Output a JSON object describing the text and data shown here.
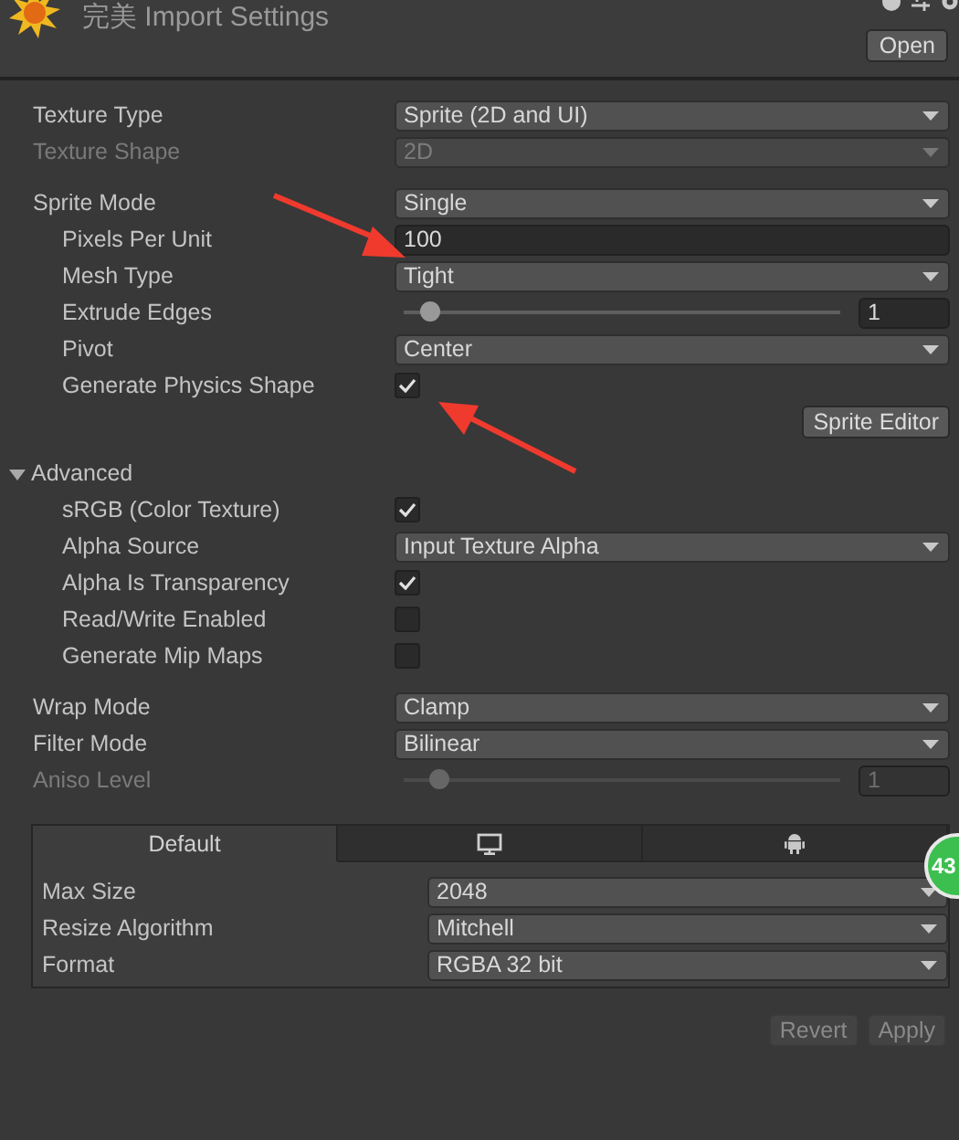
{
  "header": {
    "title": "完美 Import Settings",
    "open_button": "Open"
  },
  "groups": [
    {
      "rows": [
        {
          "kind": "dropdown",
          "label": "Texture Type",
          "value": "Sprite (2D and UI)",
          "disabled": false
        },
        {
          "kind": "dropdown",
          "label": "Texture Shape",
          "value": "2D",
          "disabled": true
        }
      ]
    },
    {
      "rows": [
        {
          "kind": "dropdown",
          "label": "Sprite Mode",
          "value": "Single",
          "disabled": false,
          "children": [
            {
              "kind": "input",
              "label": "Pixels Per Unit",
              "value": "100",
              "disabled": false
            },
            {
              "kind": "dropdown",
              "label": "Mesh Type",
              "value": "Tight",
              "disabled": false
            },
            {
              "kind": "slider",
              "label": "Extrude Edges",
              "level": 0.06,
              "value": "1",
              "disabled": false
            },
            {
              "kind": "dropdown",
              "label": "Pivot",
              "value": "Center",
              "disabled": false
            },
            {
              "kind": "checkbox",
              "label": "Generate Physics Shape",
              "checked": true,
              "disabled": false
            }
          ]
        },
        {
          "kind": "button",
          "label": "Sprite Editor",
          "disabled": false
        }
      ]
    },
    {
      "rows": [
        {
          "kind": "foldout",
          "label": "Advanced",
          "expanded": true,
          "disabled": false,
          "children": [
            {
              "kind": "checkbox",
              "label": "sRGB (Color Texture)",
              "checked": true,
              "disabled": false
            },
            {
              "kind": "dropdown",
              "label": "Alpha Source",
              "value": "Input Texture Alpha",
              "disabled": false
            },
            {
              "kind": "checkbox",
              "label": "Alpha Is Transparency",
              "checked": true,
              "disabled": false
            },
            {
              "kind": "checkbox",
              "label": "Read/Write Enabled",
              "checked": false,
              "disabled": false
            },
            {
              "kind": "checkbox",
              "label": "Generate Mip Maps",
              "checked": false,
              "disabled": false
            }
          ]
        }
      ]
    },
    {
      "rows": [
        {
          "kind": "dropdown",
          "label": "Wrap Mode",
          "value": "Clamp",
          "disabled": false
        },
        {
          "kind": "dropdown",
          "label": "Filter Mode",
          "value": "Bilinear",
          "disabled": false
        },
        {
          "kind": "slider",
          "label": "Aniso Level",
          "level": 0.08,
          "value": "1",
          "disabled": true
        }
      ]
    }
  ],
  "platform_settings": {
    "tabs": [
      {
        "kind": "text",
        "label": "Default",
        "selected": true
      },
      {
        "kind": "monitor",
        "selected": false
      },
      {
        "kind": "android",
        "selected": false
      }
    ],
    "rows": [
      {
        "kind": "dropdown",
        "label": "Max Size",
        "value": "2048",
        "disabled": false
      },
      {
        "kind": "dropdown",
        "label": "Resize Algorithm",
        "value": "Mitchell",
        "disabled": false
      },
      {
        "kind": "dropdown",
        "label": "Format",
        "value": "RGBA 32 bit",
        "disabled": false
      }
    ]
  },
  "buttons": [
    {
      "label": "Revert",
      "disabled": true
    },
    {
      "label": "Apply",
      "disabled": true
    }
  ],
  "badge": "43"
}
